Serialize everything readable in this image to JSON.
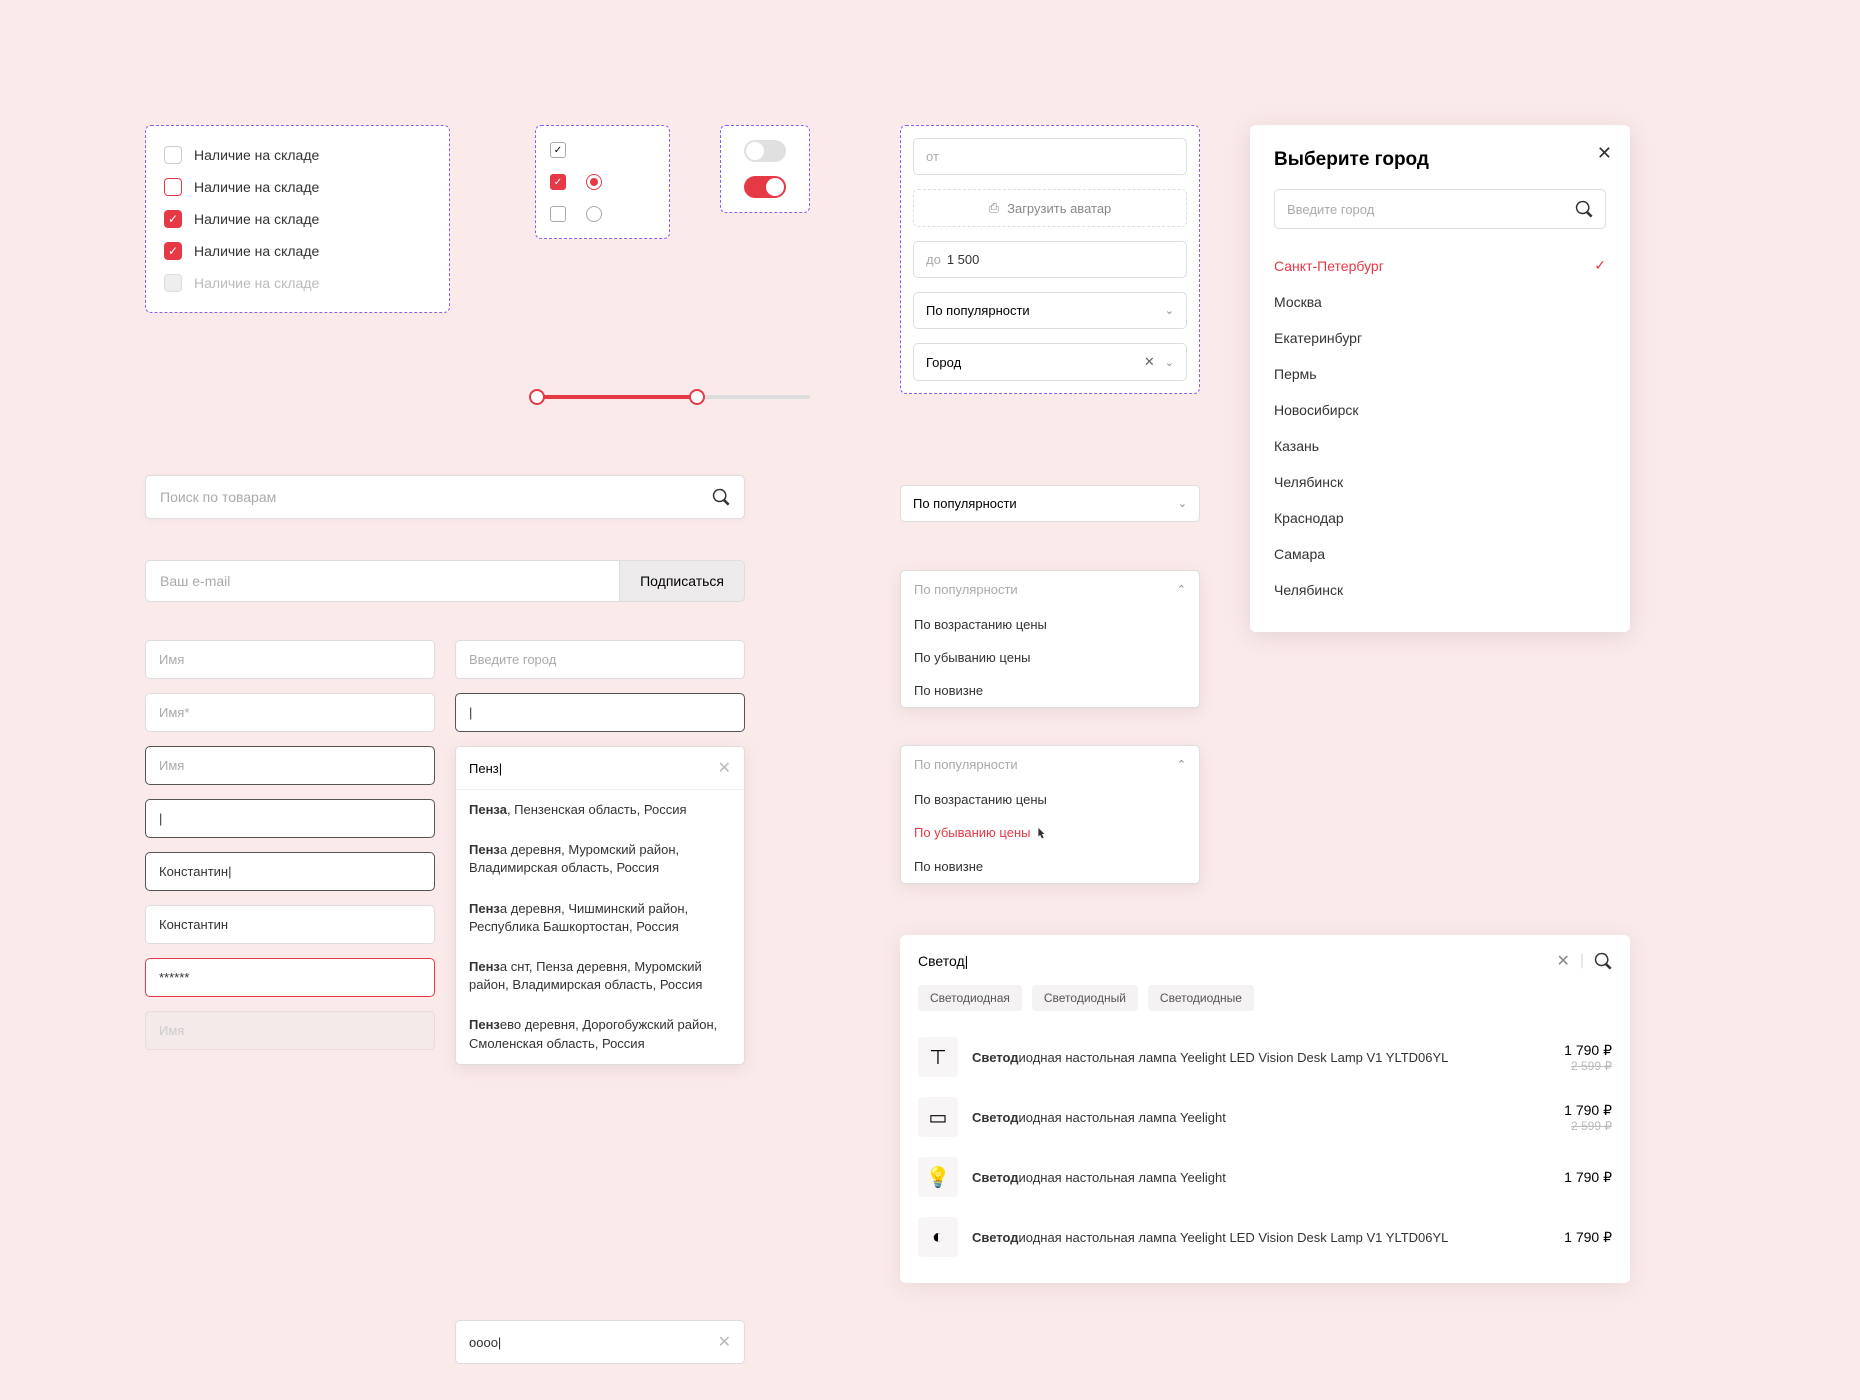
{
  "checkbox_label": "Наличие на складе",
  "price_from_placeholder": "от",
  "price_to_prefix": "до",
  "price_to_value": "1 500",
  "upload_label": "Загрузить аватар",
  "sort_label": "По популярности",
  "city_select_label": "Город",
  "city_modal": {
    "title": "Выберите город",
    "placeholder": "Введите город",
    "selected": "Санкт-Петербург",
    "items": [
      "Москва",
      "Екатеринбург",
      "Пермь",
      "Новосибирск",
      "Казань",
      "Челябинск",
      "Краснодар",
      "Самара",
      "Челябинск"
    ]
  },
  "search_placeholder": "Поиск по товарам",
  "email_placeholder": "Ваш e-mail",
  "subscribe_btn": "Подписаться",
  "name_ph": "Имя",
  "name_required": "Имя*",
  "name_value": "Константин",
  "name_value_cursor": "Константин|",
  "password_mask": "******",
  "city_ph": "Введите город",
  "cursor_only": "|",
  "penz_query": "Пенз|",
  "penz_results": [
    {
      "b": "Пенза",
      "rest": ", Пензенская область, Россия"
    },
    {
      "b": "Пенз",
      "rest": "а деревня, Муромский район, Владимирская область, Россия"
    },
    {
      "b": "Пенз",
      "rest": "а деревня, Чишминский район, Республика Башкортостан, Россия"
    },
    {
      "b": "Пенз",
      "rest": "а снт, Пенза деревня, Муромский район, Владимирская область, Россия"
    },
    {
      "b": "Пенз",
      "rest": "ево деревня, Дорогобужский район, Смоленская область, Россия"
    }
  ],
  "oooo_query": "oooo|",
  "sort_options": [
    "По возрастанию цены",
    "По убыванию цены",
    "По новизне"
  ],
  "search_panel": {
    "query": "Светод|",
    "chips": [
      "Светодиодная",
      "Светодиодный",
      "Светодиодные"
    ],
    "bold_prefix": "Светод",
    "results": [
      {
        "title": "иодная настольная лампа Yeelight LED Vision Desk Lamp V1 YLTD06YL",
        "price": "1 790 ₽",
        "old": "2 599 ₽",
        "icon": "lamp"
      },
      {
        "title": "иодная настольная лампа Yeelight",
        "price": "1 790 ₽",
        "old": "2 599 ₽",
        "icon": "panel"
      },
      {
        "title": "иодная настольная лампа Yeelight",
        "price": "1 790 ₽",
        "old": "",
        "icon": "bulb"
      },
      {
        "title": "иодная настольная лампа Yeelight LED Vision Desk Lamp V1 YLTD06YL",
        "price": "1 790 ₽",
        "old": "",
        "icon": "sensor"
      }
    ]
  }
}
